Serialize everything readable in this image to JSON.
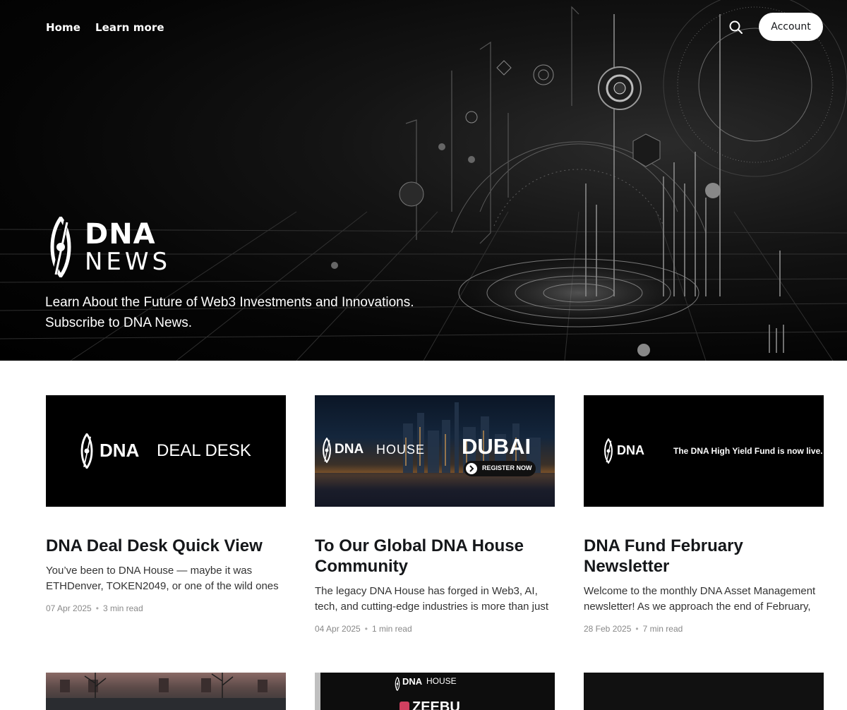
{
  "nav": {
    "home_label": "Home",
    "learn_label": "Learn more",
    "account_label": "Account"
  },
  "hero": {
    "logo_line1": "DNA",
    "logo_line2": "NEWS",
    "tagline_line1": "Learn About the Future of Web3 Investments and Innovations.",
    "tagline_line2": "Subscribe to DNA News."
  },
  "posts": [
    {
      "image": {
        "brand": "DNA",
        "text": "DEAL DESK"
      },
      "title": "DNA Deal Desk Quick View",
      "excerpt": "You’ve been to DNA House — maybe it was ETHDenver, TOKEN2049, or one of the wild ones li...",
      "date": "07 Apr 2025",
      "read_time": "3 min read"
    },
    {
      "image": {
        "brand": "DNA",
        "text": "HOUSE",
        "city": "DUBAI",
        "cta": "REGISTER NOW"
      },
      "title": "To Our Global DNA House Community",
      "excerpt": "The legacy DNA House has forged in Web3, AI, tech, and cutting-edge industries is more than just a...",
      "date": "04 Apr 2025",
      "read_time": "1 min read"
    },
    {
      "image": {
        "brand": "DNA",
        "text": "The DNA High Yield Fund is now live."
      },
      "title": "DNA Fund February Newsletter",
      "excerpt": "Welcome to the monthly DNA Asset Management newsletter! As we approach the end of February, t...",
      "date": "28 Feb 2025",
      "read_time": "7 min read"
    }
  ],
  "bottom_row": {
    "card2_brand": "DNA",
    "card2_text": "HOUSE",
    "card2_partial": "ZEEBU"
  },
  "colors": {
    "hero_bg": "#000000",
    "account_bg": "#ffffff",
    "title_text": "#15171a",
    "meta_text": "#888888"
  },
  "icons": [
    "search-icon",
    "dna-logo-icon"
  ]
}
